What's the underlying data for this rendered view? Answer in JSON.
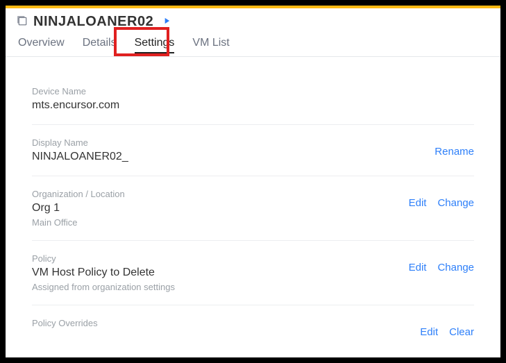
{
  "header": {
    "title": "NINJALOANER02"
  },
  "tabs": {
    "overview": "Overview",
    "details": "Details",
    "settings": "Settings",
    "vmlist": "VM List"
  },
  "settings": {
    "deviceName": {
      "label": "Device Name",
      "value": "mts.encursor.com"
    },
    "displayName": {
      "label": "Display Name",
      "value": "NINJALOANER02_",
      "action1": "Rename"
    },
    "orgLocation": {
      "label": "Organization / Location",
      "value": "Org 1",
      "sub": "Main Office",
      "action1": "Edit",
      "action2": "Change"
    },
    "policy": {
      "label": "Policy",
      "value": "VM Host Policy to Delete",
      "sub": "Assigned from organization settings",
      "action1": "Edit",
      "action2": "Change"
    },
    "overrides": {
      "label": "Policy Overrides",
      "action1": "Edit",
      "action2": "Clear"
    }
  }
}
